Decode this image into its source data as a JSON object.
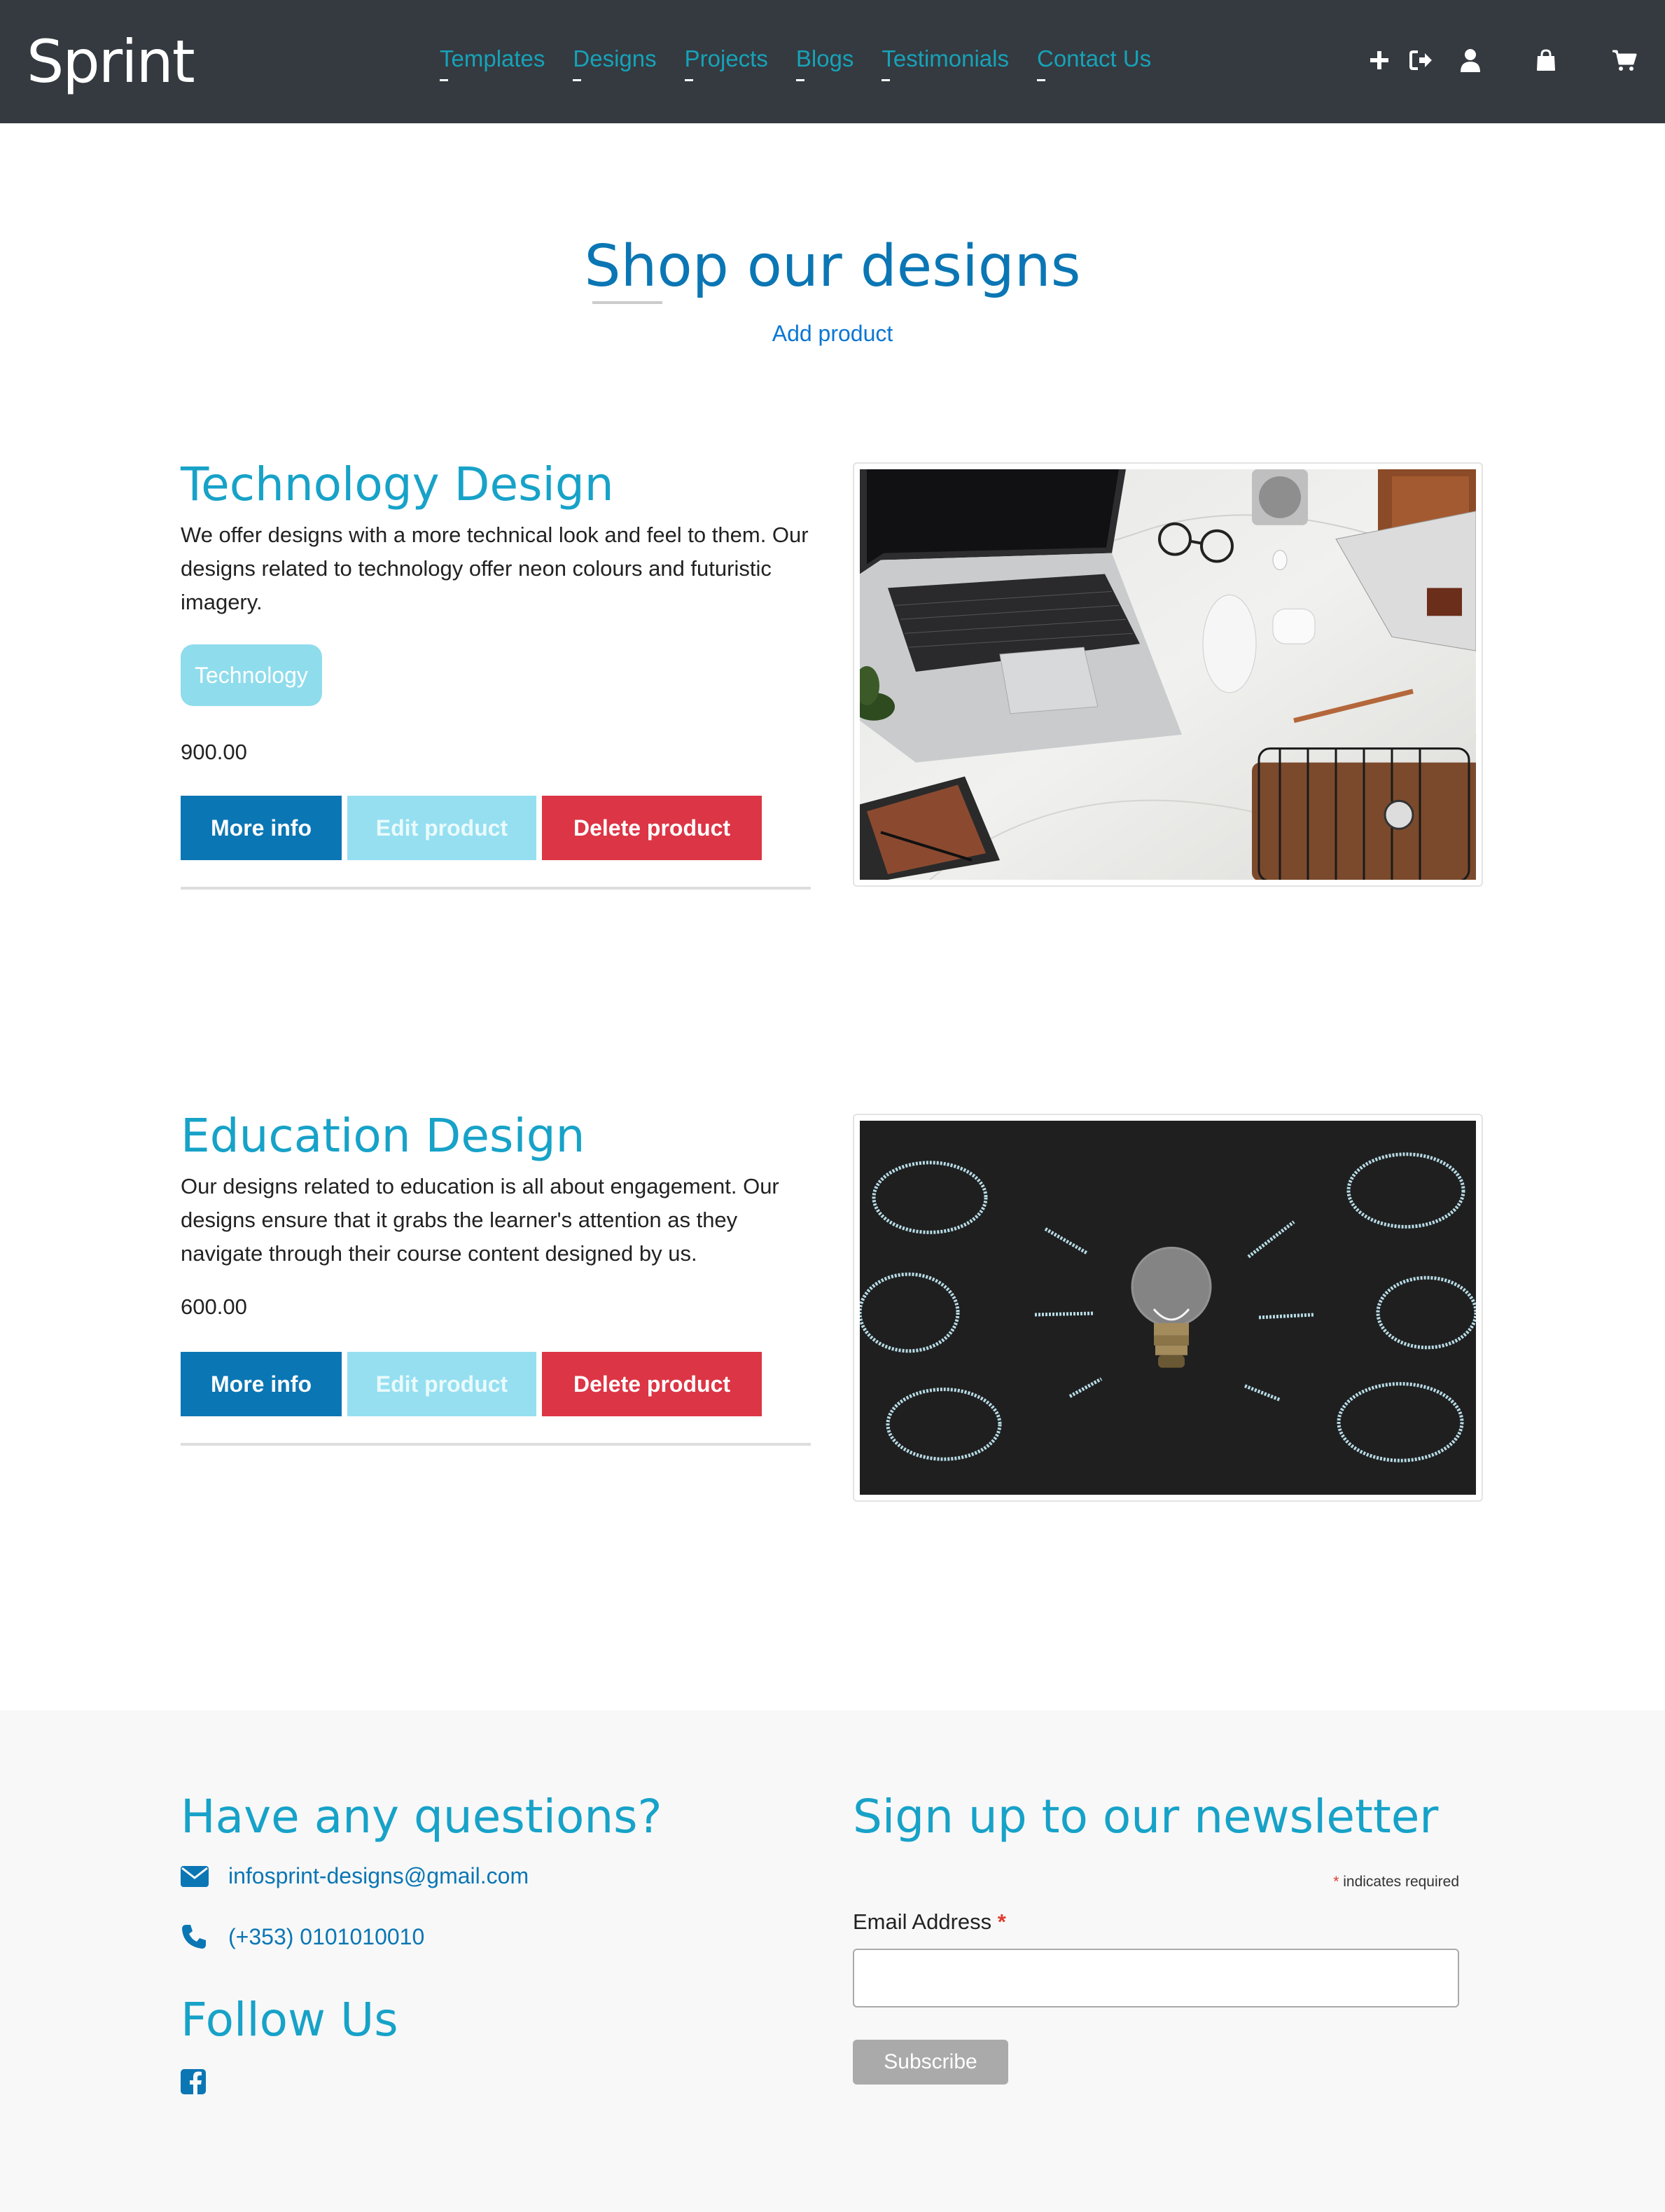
{
  "navbar": {
    "brand": "Sprint",
    "links": [
      "Templates",
      "Designs",
      "Projects",
      "Blogs",
      "Testimonials",
      "Contact Us"
    ],
    "icons": [
      "plus-icon",
      "sign-out-icon",
      "user-icon",
      "shopping-bag-icon",
      "shopping-cart-icon"
    ]
  },
  "header": {
    "title": "Shop our designs",
    "add_product": "Add product"
  },
  "products": [
    {
      "title": "Technology Design",
      "description": "We offer designs with a more technical look and feel to them. Our designs related to technology offer neon colours and futuristic imagery.",
      "tag": "Technology",
      "price": "900.00",
      "buttons": {
        "more_info": "More info",
        "edit": "Edit product",
        "delete": "Delete product"
      },
      "image": "laptop-desk-photo"
    },
    {
      "title": "Education Design",
      "description": "Our designs related to education is all about engagement. Our designs ensure that it grabs the learner's attention as they navigate through their course content designed by us.",
      "price": "600.00",
      "buttons": {
        "more_info": "More info",
        "edit": "Edit product",
        "delete": "Delete product"
      },
      "image": "lightbulb-chalkboard-photo"
    }
  ],
  "footer": {
    "questions_title": "Have any questions?",
    "email": "infosprint-designs@gmail.com",
    "phone": "(+353) 0101010010",
    "follow_title": "Follow Us",
    "newsletter_title": "Sign up to our newsletter",
    "required_star": "*",
    "required_note": "indicates required",
    "email_label": "Email Address",
    "email_placeholder": "",
    "subscribe_label": "Subscribe"
  },
  "colors": {
    "navbar_bg": "#343a40",
    "accent_cyan": "#17a2b8",
    "primary_blue": "#0b76b4",
    "danger_red": "#dc3545",
    "edit_light_cyan": "#95dff0"
  }
}
